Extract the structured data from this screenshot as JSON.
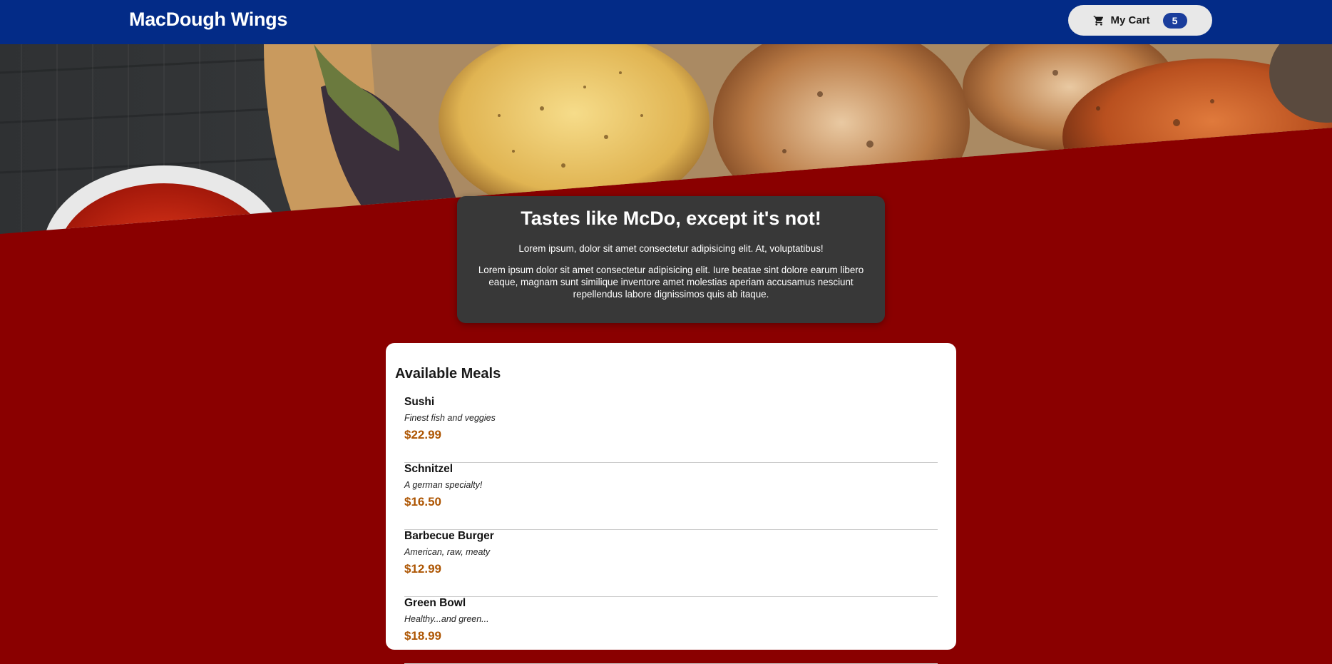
{
  "header": {
    "brand": "MacDough Wings",
    "cart": {
      "icon": "shopping-cart-icon",
      "label": "My Cart",
      "count": "5"
    }
  },
  "hero": {
    "image": "grilled-food-banner"
  },
  "summary": {
    "title": "Tastes like McDo, except it's not!",
    "paragraph1": "Lorem ipsum, dolor sit amet consectetur adipisicing elit. At, voluptatibus!",
    "paragraph2": "Lorem ipsum dolor sit amet consectetur adipisicing elit. Iure beatae sint dolore earum libero eaque, magnam sunt similique inventore amet molestias aperiam accusamus nesciunt repellendus labore dignissimos quis ab itaque."
  },
  "meals": {
    "title": "Available Meals",
    "items": [
      {
        "name": "Sushi",
        "description": "Finest fish and veggies",
        "price": "$22.99"
      },
      {
        "name": "Schnitzel",
        "description": "A german specialty!",
        "price": "$16.50"
      },
      {
        "name": "Barbecue Burger",
        "description": "American, raw, meaty",
        "price": "$12.99"
      },
      {
        "name": "Green Bowl",
        "description": "Healthy...and green...",
        "price": "$18.99"
      }
    ]
  },
  "colors": {
    "header_bg": "#032b87",
    "page_bg": "#8a0000",
    "summary_bg": "#383838",
    "price": "#ad5502",
    "badge_bg": "#1a3d9c"
  }
}
